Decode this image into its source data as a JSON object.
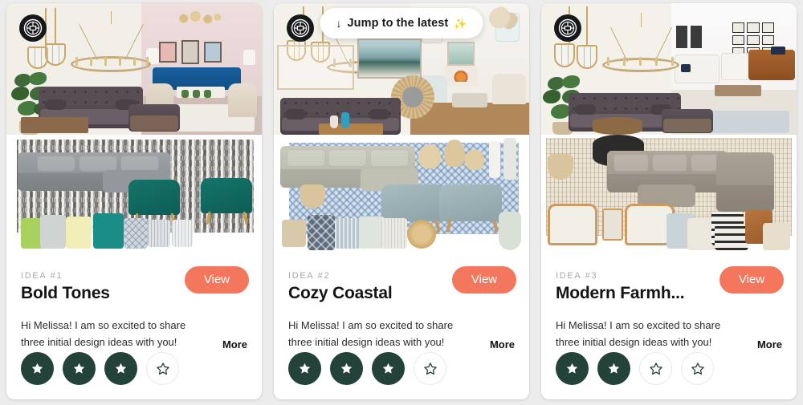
{
  "page": {
    "background_color": "#ececec",
    "accent_color": "#f4775d",
    "star_filled_color": "#23423a",
    "star_empty_color": "#e9e9e9",
    "badge_color": "#17181a"
  },
  "jump_pill": {
    "arrow_icon": "down-arrow-icon",
    "label": "Jump to the latest",
    "sparkle_icon": "sparkles-icon",
    "sparkle_glyph": "✨",
    "arrow_glyph": "↓"
  },
  "cards": [
    {
      "eyebrow": "IDEA #1",
      "title": "Bold Tones",
      "description": "Hi Melissa! I am so excited to share three initial design ideas with you! Consider this t...",
      "more_label": "More",
      "view_label": "View",
      "rating": 3,
      "rating_max": 4,
      "board_name": "moodboard-bold-tones",
      "badge_icon": "brand-badge-icon"
    },
    {
      "eyebrow": "IDEA #2",
      "title": "Cozy Coastal",
      "description": "Hi Melissa! I am so excited to share three initial design ideas with you! Consider this t...",
      "more_label": "More",
      "view_label": "View",
      "rating": 3,
      "rating_max": 4,
      "board_name": "moodboard-cozy-coastal",
      "badge_icon": "brand-badge-icon"
    },
    {
      "eyebrow": "IDEA #3",
      "title": "Modern Farmh...",
      "description": "Hi Melissa! I am so excited to share three initial design ideas with you! Consider this t...",
      "more_label": "More",
      "view_label": "View",
      "rating": 2,
      "rating_max": 4,
      "board_name": "moodboard-modern-farmhouse",
      "badge_icon": "brand-badge-icon"
    }
  ]
}
